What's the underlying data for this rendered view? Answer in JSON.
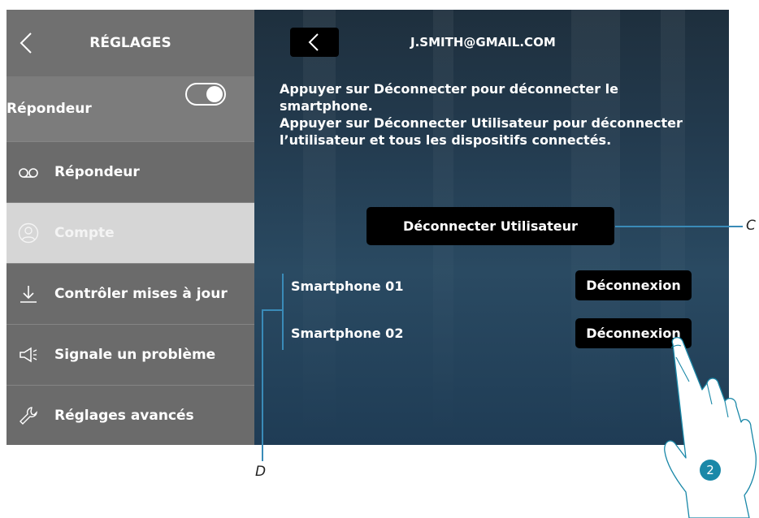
{
  "sidebar": {
    "title": "RÉGLAGES",
    "toggle_row": {
      "label": "Répondeur",
      "state": "on"
    },
    "items": [
      {
        "label": "Répondeur",
        "icon": "voicemail-icon",
        "active": false
      },
      {
        "label": "Compte",
        "icon": "user-circle-icon",
        "active": true
      },
      {
        "label": "Contrôler mises à jour",
        "icon": "download-icon",
        "active": false
      },
      {
        "label": "Signale un problème",
        "icon": "megaphone-icon",
        "active": false
      },
      {
        "label": "Réglages avancés",
        "icon": "wrench-icon",
        "active": false
      }
    ]
  },
  "main": {
    "email": "J.SMITH@GMAIL.COM",
    "instructions": "Appuyer sur Déconnecter pour déconnecter le smartphone.\nAppuyer sur Déconnecter Utilisateur pour déconnecter l’utilisateur et tous les dispositifs connectés.",
    "disconnect_user_label": "Déconnecter Utilisateur",
    "devices": [
      {
        "name": "Smartphone 01",
        "button": "Déconnexion"
      },
      {
        "name": "Smartphone 02",
        "button": "Déconnexion"
      }
    ]
  },
  "callouts": {
    "c": "C",
    "d": "D",
    "step": "2"
  },
  "colors": {
    "accent": "#1a88a8",
    "callout_line": "#3a8bb8",
    "sidebar_bg": "#6b6b6b",
    "active_item": "#d6d6d6"
  }
}
